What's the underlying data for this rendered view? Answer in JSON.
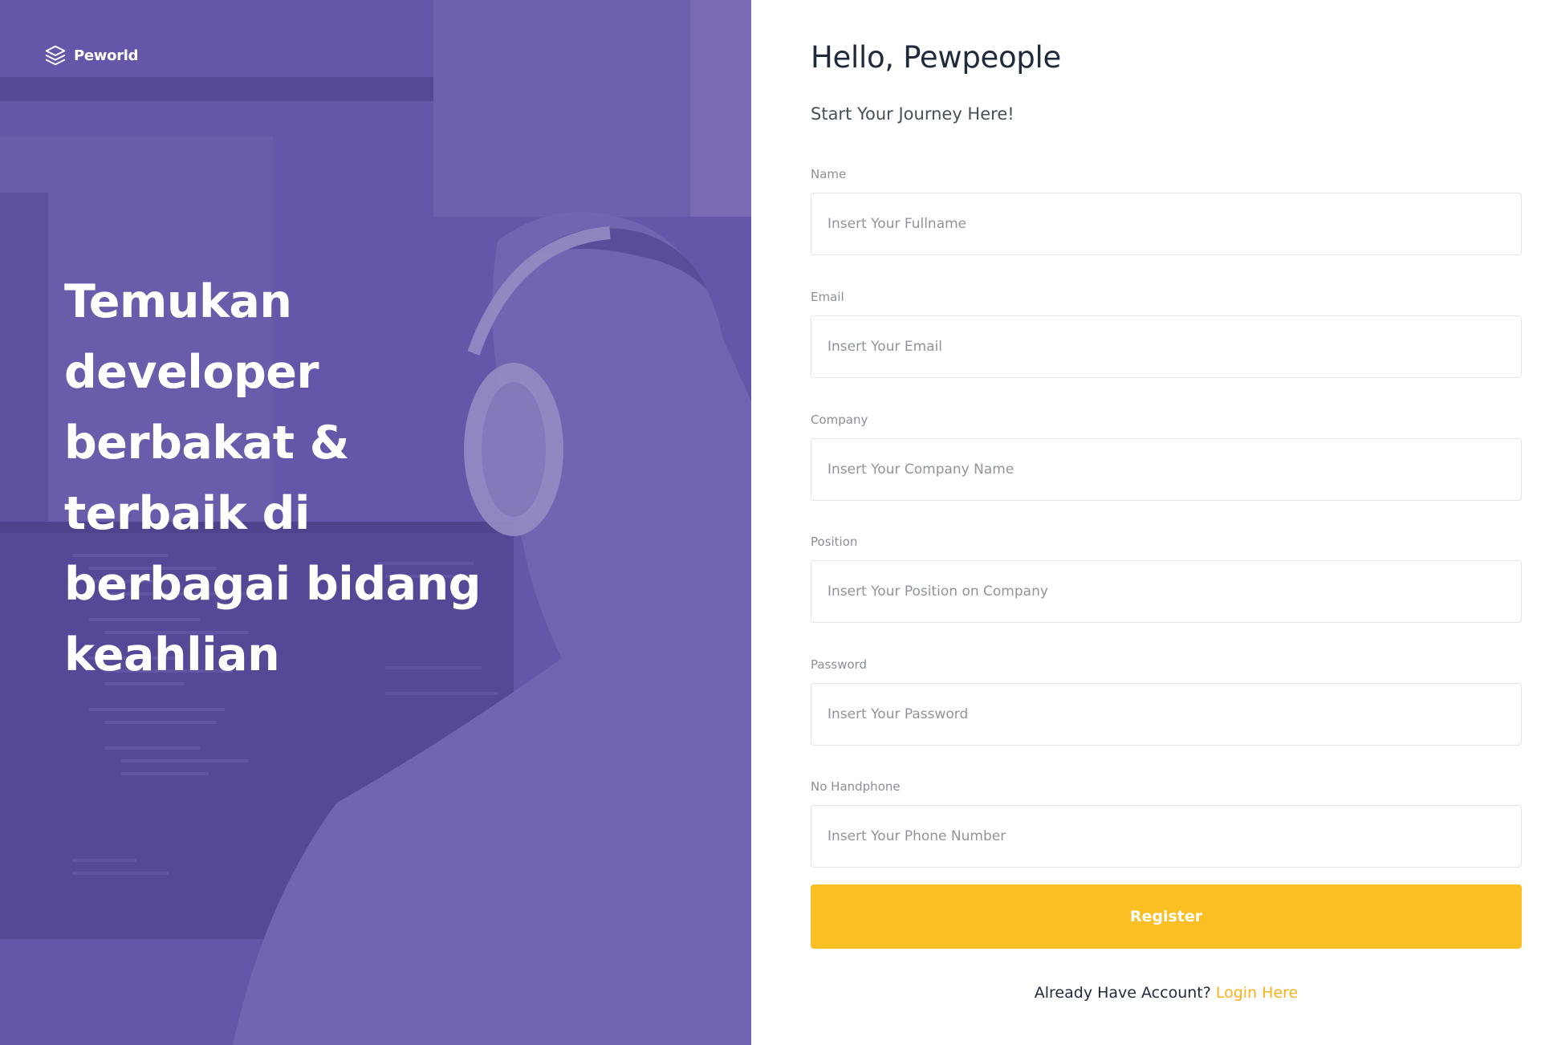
{
  "brand": {
    "name": "Peworld",
    "icon": "layers-icon"
  },
  "hero": {
    "headline": "Temukan developer berbakat & terbaik di berbagai bidang keahlian",
    "background_color": "#6b5bb0"
  },
  "form": {
    "title": "Hello, Pewpeople",
    "subtitle": "Start Your Journey Here!",
    "fields": [
      {
        "label": "Name",
        "placeholder": "Insert Your Fullname",
        "value": ""
      },
      {
        "label": "Email",
        "placeholder": "Insert Your Email",
        "value": ""
      },
      {
        "label": "Company",
        "placeholder": "Insert Your Company Name",
        "value": ""
      },
      {
        "label": "Position",
        "placeholder": "Insert Your Position on Company",
        "value": ""
      },
      {
        "label": "Password",
        "placeholder": "Insert Your Password",
        "value": ""
      },
      {
        "label": "No Handphone",
        "placeholder": "Insert Your Phone Number",
        "value": ""
      }
    ],
    "submit_label": "Register",
    "login_prompt": "Already Have Account?",
    "login_link": "Login Here"
  },
  "colors": {
    "accent": "#fbbf24",
    "link": "#fbb11a",
    "title": "#1f2a3c"
  }
}
